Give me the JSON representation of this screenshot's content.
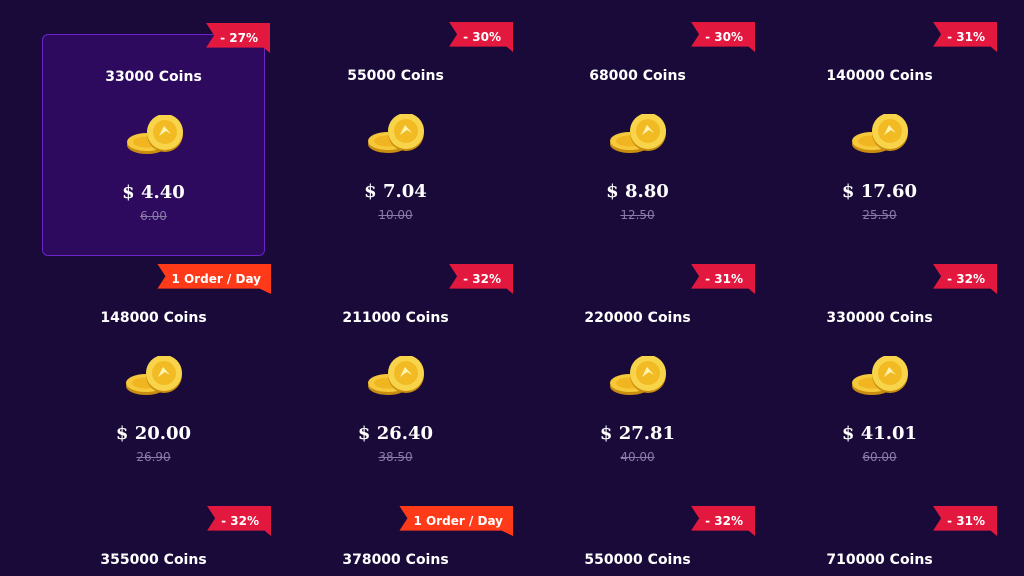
{
  "colors": {
    "background": "#1a0a3a",
    "selected_card": "#2d0a5e",
    "discount_badge": "#e3183f",
    "order_badge": "#ff3a18",
    "old_price": "#8a7aa8"
  },
  "icons": {
    "coin": "gold-coins-icon"
  },
  "packages": [
    {
      "title": "33000 Coins",
      "price": "$ 4.40",
      "old_price": "6.00",
      "badge": "- 27%",
      "badge_type": "discount",
      "selected": true
    },
    {
      "title": "55000 Coins",
      "price": "$ 7.04",
      "old_price": "10.00",
      "badge": "- 30%",
      "badge_type": "discount"
    },
    {
      "title": "68000 Coins",
      "price": "$ 8.80",
      "old_price": "12.50",
      "badge": "- 30%",
      "badge_type": "discount"
    },
    {
      "title": "140000 Coins",
      "price": "$ 17.60",
      "old_price": "25.50",
      "badge": "- 31%",
      "badge_type": "discount"
    },
    {
      "title": "148000 Coins",
      "price": "$ 20.00",
      "old_price": "26.90",
      "badge": "1 Order / Day",
      "badge_type": "order"
    },
    {
      "title": "211000 Coins",
      "price": "$ 26.40",
      "old_price": "38.50",
      "badge": "- 32%",
      "badge_type": "discount"
    },
    {
      "title": "220000 Coins",
      "price": "$ 27.81",
      "old_price": "40.00",
      "badge": "- 31%",
      "badge_type": "discount"
    },
    {
      "title": "330000 Coins",
      "price": "$ 41.01",
      "old_price": "60.00",
      "badge": "- 32%",
      "badge_type": "discount"
    },
    {
      "title": "355000 Coins",
      "price": "",
      "old_price": "",
      "badge": "- 32%",
      "badge_type": "discount"
    },
    {
      "title": "378000 Coins",
      "price": "",
      "old_price": "",
      "badge": "1 Order / Day",
      "badge_type": "order"
    },
    {
      "title": "550000 Coins",
      "price": "",
      "old_price": "",
      "badge": "- 32%",
      "badge_type": "discount"
    },
    {
      "title": "710000 Coins",
      "price": "",
      "old_price": "",
      "badge": "- 31%",
      "badge_type": "discount"
    }
  ]
}
